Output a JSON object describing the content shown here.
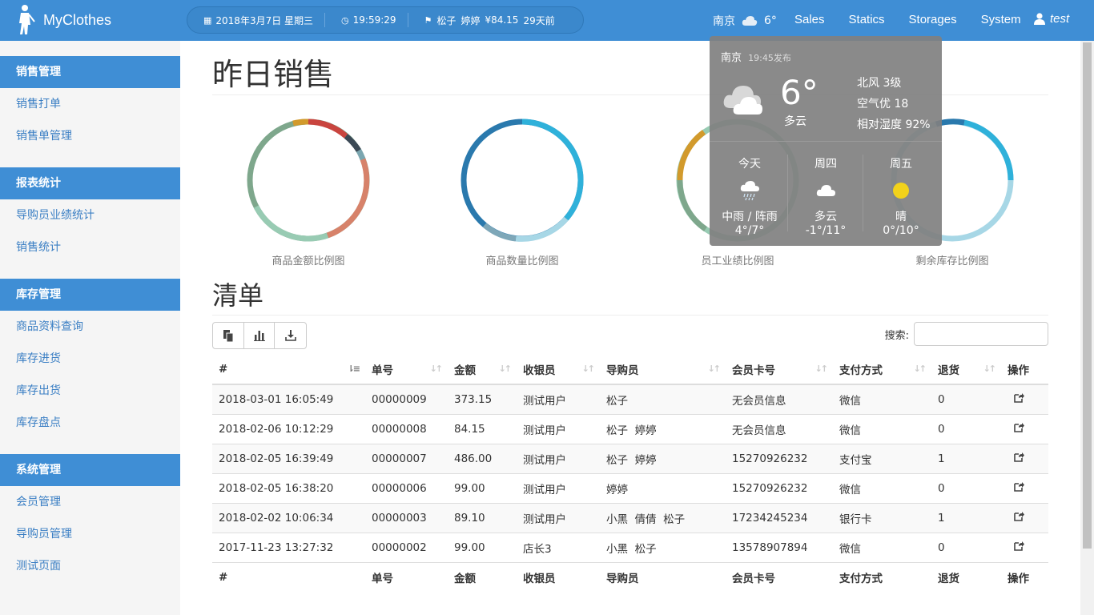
{
  "navbar": {
    "brand": "MyClothes",
    "date": "2018年3月7日 星期三",
    "time": "19:59:29",
    "ticker_names": [
      "松子",
      "婷婷"
    ],
    "ticker_amount": "¥84.15",
    "ticker_ago": "29天前",
    "weather_city": "南京",
    "weather_temp": "6°",
    "links": [
      "Sales",
      "Statics",
      "Storages",
      "System"
    ],
    "user": "test"
  },
  "sidebar": {
    "groups": [
      {
        "title": "销售管理",
        "items": [
          "销售打单",
          "销售单管理"
        ]
      },
      {
        "title": "报表统计",
        "items": [
          "导购员业绩统计",
          "销售统计"
        ]
      },
      {
        "title": "库存管理",
        "items": [
          "商品资料查询",
          "库存进货",
          "库存出货",
          "库存盘点"
        ]
      },
      {
        "title": "系统管理",
        "items": [
          "会员管理",
          "导购员管理",
          "测试页面"
        ]
      }
    ]
  },
  "main": {
    "title": "昨日销售",
    "charts": [
      "商品金额比例图",
      "商品数量比例图",
      "员工业绩比例图",
      "剩余库存比例图"
    ],
    "list_title": "清单",
    "search_label": "搜索:"
  },
  "table": {
    "headers": [
      "#",
      "单号",
      "金额",
      "收银员",
      "导购员",
      "会员卡号",
      "支付方式",
      "退货",
      "操作"
    ],
    "rows": [
      {
        "time": "2018-03-01 16:05:49",
        "no": "00000009",
        "amount": "373.15",
        "cashier": "测试用户",
        "guides": "松子",
        "card": "无会员信息",
        "pay": "微信",
        "ret": "0"
      },
      {
        "time": "2018-02-06 10:12:29",
        "no": "00000008",
        "amount": "84.15",
        "cashier": "测试用户",
        "guides": "松子  婷婷",
        "card": "无会员信息",
        "pay": "微信",
        "ret": "0"
      },
      {
        "time": "2018-02-05 16:39:49",
        "no": "00000007",
        "amount": "486.00",
        "cashier": "测试用户",
        "guides": "松子  婷婷",
        "card": "15270926232",
        "pay": "支付宝",
        "ret": "1"
      },
      {
        "time": "2018-02-05 16:38:20",
        "no": "00000006",
        "amount": "99.00",
        "cashier": "测试用户",
        "guides": "婷婷",
        "card": "15270926232",
        "pay": "微信",
        "ret": "0"
      },
      {
        "time": "2018-02-02 10:06:34",
        "no": "00000003",
        "amount": "89.10",
        "cashier": "测试用户",
        "guides": "小黑  倩倩  松子",
        "card": "17234245234",
        "pay": "银行卡",
        "ret": "1"
      },
      {
        "time": "2017-11-23 13:27:32",
        "no": "00000002",
        "amount": "99.00",
        "cashier": "店长3",
        "guides": "小黑  松子",
        "card": "13578907894",
        "pay": "微信",
        "ret": "0"
      }
    ]
  },
  "weather": {
    "city": "南京",
    "published": "19:45发布",
    "temp": "6°",
    "desc": "多云",
    "wind": "北风 3级",
    "air": "空气优 18",
    "humidity": "相对湿度 92%",
    "forecast": [
      {
        "day": "今天",
        "icon": "rain-cloud-icon",
        "desc": "中雨 / 阵雨",
        "range": "4°/7°"
      },
      {
        "day": "周四",
        "icon": "cloud-icon",
        "desc": "多云",
        "range": "-1°/11°"
      },
      {
        "day": "周五",
        "icon": "sun-icon",
        "desc": "晴",
        "range": "0°/10°"
      }
    ]
  },
  "colors": {
    "primary": "#3f8ed5",
    "link": "#3b7fc4"
  }
}
